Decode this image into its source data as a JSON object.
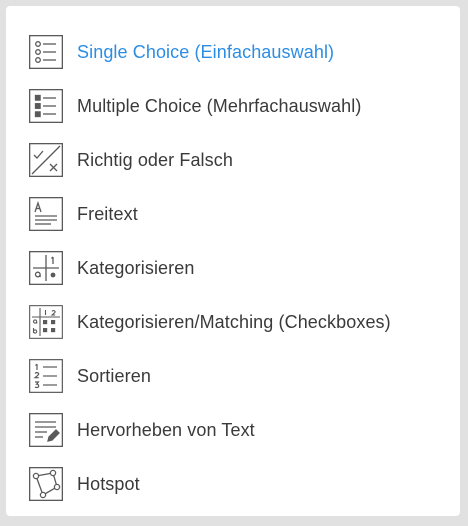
{
  "menu": {
    "items": [
      {
        "label": "Single Choice (Einfachauswahl)",
        "icon": "single-choice-icon",
        "active": true
      },
      {
        "label": "Multiple Choice (Mehrfachauswahl)",
        "icon": "multiple-choice-icon"
      },
      {
        "label": "Richtig oder Falsch",
        "icon": "true-false-icon"
      },
      {
        "label": "Freitext",
        "icon": "free-text-icon"
      },
      {
        "label": "Kategorisieren",
        "icon": "categorize-icon"
      },
      {
        "label": "Kategorisieren/Matching (Checkboxes)",
        "icon": "matching-icon"
      },
      {
        "label": "Sortieren",
        "icon": "sort-icon"
      },
      {
        "label": "Hervorheben von Text",
        "icon": "highlight-text-icon"
      },
      {
        "label": "Hotspot",
        "icon": "hotspot-icon"
      }
    ]
  },
  "colors": {
    "active": "#2b8de4",
    "text": "#3a3a3a",
    "icon": "#5a5a5a",
    "background": "#e1e1e1",
    "panel": "#ffffff"
  }
}
